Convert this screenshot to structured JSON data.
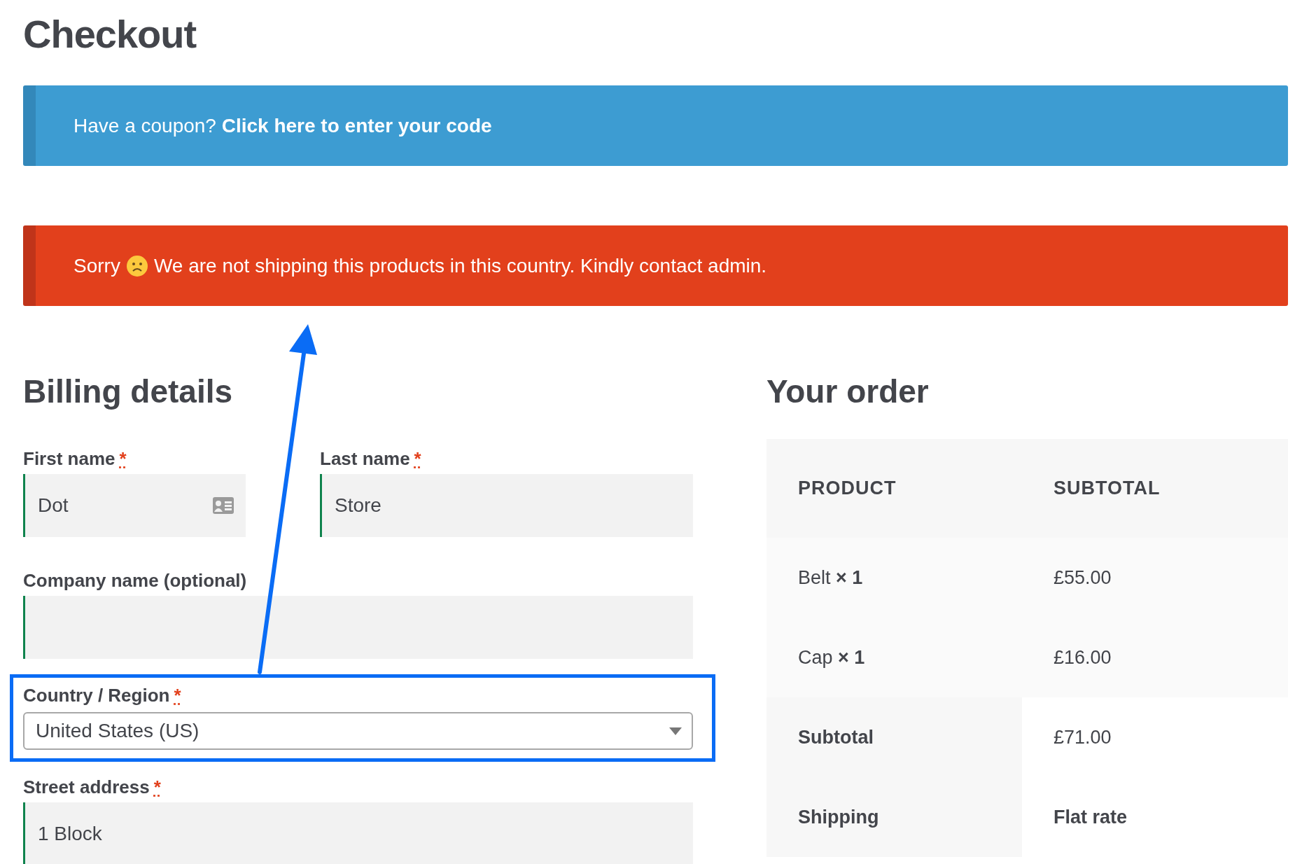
{
  "page_title": "Checkout",
  "coupon_notice": {
    "text": "Have a coupon?",
    "link": "Click here to enter your code"
  },
  "error_notice": {
    "lead": "Sorry",
    "text": "We are not shipping this products in this country. Kindly contact admin."
  },
  "billing": {
    "heading": "Billing details",
    "fields": [
      {
        "kind": "input",
        "label": "First name",
        "required_mark": "*",
        "value": "Dot",
        "validated": true,
        "half": true,
        "card_icon": true
      },
      {
        "kind": "input",
        "label": "Last name",
        "required_mark": "*",
        "value": "Store",
        "validated": true,
        "half": true
      },
      {
        "kind": "input",
        "label": "Company name (optional)",
        "validated": true
      },
      {
        "kind": "select",
        "label": "Country / Region",
        "required_mark": "*",
        "value": "United States (US)",
        "highlighted": true
      },
      {
        "kind": "input",
        "label": "Street address",
        "required_mark": "*",
        "value": "1 Block",
        "validated": true
      }
    ]
  },
  "order": {
    "heading": "Your order",
    "columns": [
      "PRODUCT",
      "SUBTOTAL"
    ],
    "rows": [
      {
        "kind": "item",
        "cells": [
          "Belt **× 1**",
          "£55.00"
        ]
      },
      {
        "kind": "item",
        "cells": [
          "Cap **× 1**",
          "£16.00"
        ]
      },
      {
        "kind": "total",
        "cells": [
          "Subtotal",
          "£71.00"
        ]
      },
      {
        "kind": "shipping",
        "cells": [
          "Shipping",
          "Flat rate"
        ]
      }
    ]
  }
}
